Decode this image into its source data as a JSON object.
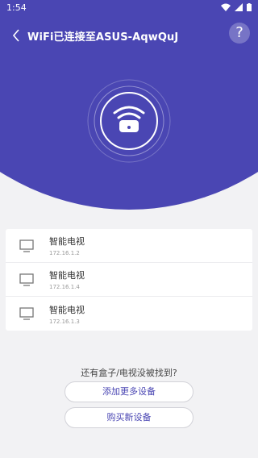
{
  "status": {
    "time": "1:54"
  },
  "header": {
    "title": "WiFi已连接至ASUS-AqwQuJ",
    "help_label": "?"
  },
  "devices": [
    {
      "name": "智能电视",
      "ip": "172.16.1.2"
    },
    {
      "name": "智能电视",
      "ip": "172.16.1.4"
    },
    {
      "name": "智能电视",
      "ip": "172.16.1.3"
    }
  ],
  "footer": {
    "question": "还有盒子/电视没被找到?",
    "add_more_label": "添加更多设备",
    "buy_label": "购买新设备"
  },
  "colors": {
    "primary": "#4a46b3",
    "background": "#f2f2f4"
  }
}
